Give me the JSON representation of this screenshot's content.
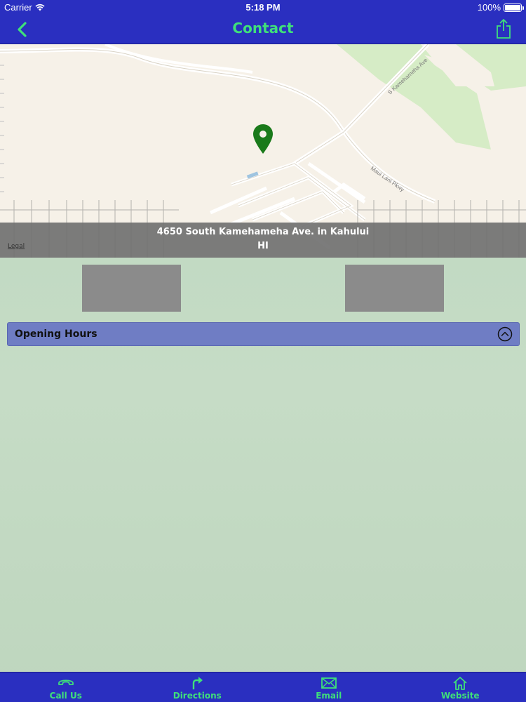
{
  "status_bar": {
    "carrier": "Carrier",
    "time": "5:18 PM",
    "battery": "100%"
  },
  "nav": {
    "title": "Contact",
    "back_icon": "chevron-left-icon",
    "share_icon": "share-icon"
  },
  "map": {
    "street_labels": [
      "S Kamehameha Ave",
      "Maui Lani Pkwy"
    ],
    "legal": "Legal",
    "address_line1": "4650 South Kamehameha Ave. in Kahului",
    "address_line2": "HI",
    "pin_icon": "map-pin-icon"
  },
  "hours": {
    "label": "Opening Hours",
    "toggle_icon": "chevron-up-circle-icon"
  },
  "tabs": [
    {
      "label": "Call Us",
      "icon": "phone-icon"
    },
    {
      "label": "Directions",
      "icon": "turn-right-arrow-icon"
    },
    {
      "label": "Email",
      "icon": "envelope-icon"
    },
    {
      "label": "Website",
      "icon": "home-icon"
    }
  ],
  "colors": {
    "bar": "#2a2fc0",
    "accent": "#3fe07a",
    "pin": "#1a7a1a",
    "hours_header": "#6f7dc4",
    "background": "#c3dbc3"
  }
}
